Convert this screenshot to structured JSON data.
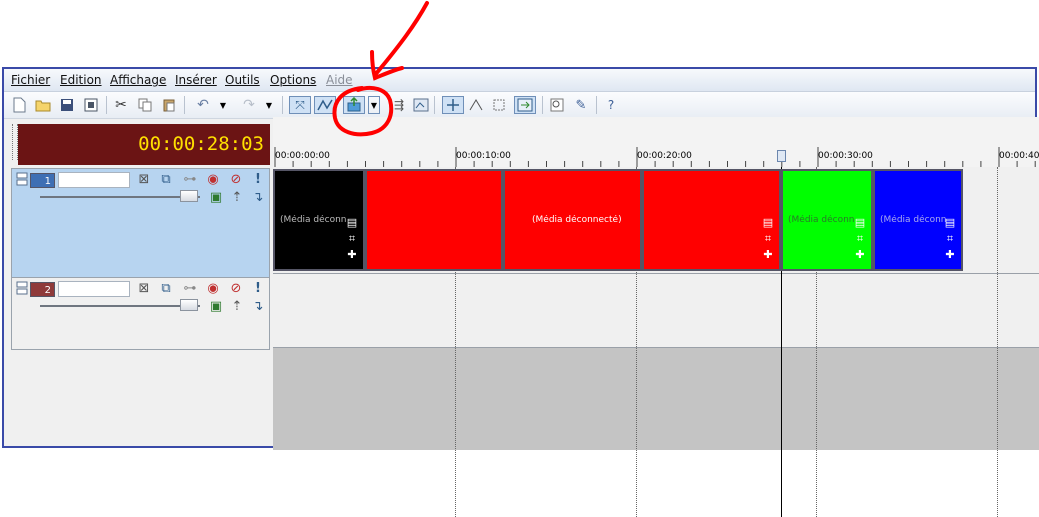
{
  "menu": [
    "Fichier",
    "Edition",
    "Affichage",
    "Insérer",
    "Outils",
    "Options",
    "Aide"
  ],
  "toolbar": {
    "icons": [
      "new-icon",
      "open-icon",
      "save-icon",
      "render-icon",
      "cut-icon",
      "copy-icon",
      "paste-icon",
      "undo-icon",
      "undo-dropdown-icon",
      "redo-icon",
      "redo-dropdown-icon",
      "normal-edit-tool-icon",
      "envelope-edit-tool-icon",
      "selection-edit-tool-icon",
      "selection-dropdown-icon",
      "auto-ripple-icon",
      "lock-envelopes-icon",
      "snapping-icon",
      "auto-crossfade-icon",
      "marker-icon",
      "properties-icon",
      "enable-snapping-icon",
      "zoom-icon",
      "paint-icon",
      "help-icon"
    ]
  },
  "time_display": "00:00:28:03",
  "ruler": {
    "labels": [
      "00:00:00:00",
      "00:00:10:00",
      "00:00:20:00",
      "00:00:30:00",
      "00:00:40:"
    ]
  },
  "tracks": [
    {
      "number": "1",
      "type": "video",
      "color": "#3e6fb4"
    },
    {
      "number": "2",
      "type": "audio",
      "color": "#8f3a3a"
    }
  ],
  "clips": [
    {
      "label": "(Média déconnecté)",
      "color": "#000000",
      "text_color": "#bbbbbb"
    },
    {
      "label": "",
      "color": "#ff0000",
      "text_color": "#ffffff"
    },
    {
      "label": "(Média déconnecté)",
      "color": "#ff0000",
      "text_color": "#ffffff"
    },
    {
      "label": "",
      "color": "#ff0000",
      "text_color": "#ffffff"
    },
    {
      "label": "(Média déconnecté)",
      "color": "#00ff00",
      "text_color": "#2a7a2a"
    },
    {
      "label": "(Média déconnecté)",
      "color": "#0000ff",
      "text_color": "#aaaaee"
    }
  ],
  "annotation": {
    "color": "#ff0000"
  }
}
